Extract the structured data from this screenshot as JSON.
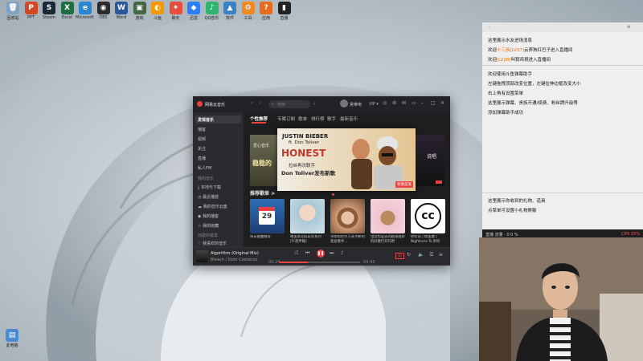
{
  "desktop_icons": [
    {
      "label": "回收站",
      "color": "#7fa3c4",
      "glyph": "🗑"
    },
    {
      "label": "PPT",
      "color": "#d24726",
      "glyph": "P"
    },
    {
      "label": "Steam",
      "color": "#1b2838",
      "glyph": "S"
    },
    {
      "label": "Excel",
      "color": "#1d6f42",
      "glyph": "X"
    },
    {
      "label": "Microsoft Edge",
      "color": "#2a86d1",
      "glyph": "e"
    },
    {
      "label": "OBS",
      "color": "#2b2b2b",
      "glyph": "◉"
    },
    {
      "label": "Word",
      "color": "#2b579a",
      "glyph": "W"
    },
    {
      "label": "游戏",
      "color": "#446644",
      "glyph": "▣"
    },
    {
      "label": "斗鱼",
      "color": "#f39800",
      "glyph": "◐"
    },
    {
      "label": "聊天",
      "color": "#e84d3d",
      "glyph": "✦"
    },
    {
      "label": "迅雷",
      "color": "#2d7ff9",
      "glyph": "◆"
    },
    {
      "label": "QQ音乐",
      "color": "#2fb56f",
      "glyph": "♪"
    },
    {
      "label": "软件",
      "color": "#3b82c4",
      "glyph": "▲"
    },
    {
      "label": "工具",
      "color": "#f08a24",
      "glyph": "⚙"
    },
    {
      "label": "应用",
      "color": "#e86a1a",
      "glyph": "?"
    },
    {
      "label": "直播",
      "color": "#222222",
      "glyph": "▮"
    }
  ],
  "bottom_icon": {
    "label": "此电脑"
  },
  "music": {
    "app_title": "网易云音乐",
    "side_heading": "发现音乐",
    "side_items": [
      "播客",
      "视频",
      "关注",
      "直播",
      "私人FM"
    ],
    "my_music_heading": "我的音乐",
    "my_items": [
      "本地与下载",
      "最近播放",
      "我的音乐云盘",
      "我的播客",
      "我的收藏"
    ],
    "created_heading": "创建的歌单",
    "playlist_item": "我喜欢的音乐",
    "tabs": [
      "个性推荐",
      "专属订制",
      "歌单",
      "排行榜",
      "歌手",
      "最新音乐"
    ],
    "banner_title": "JUSTIN BIEBER",
    "banner_sub": "ft. Don Toliver",
    "banner_song": "HONEST",
    "banner_cn1": "拉丝再次联手",
    "banner_cn2": "Don Toliver发布新歌",
    "banner_left": "稳稳的",
    "banner_left_small": "爱心音乐",
    "banner_right": "说唱",
    "banner_badge": "新歌首发",
    "rec_heading": "推荐歌单 >",
    "cards": [
      {
        "caption": "每日歌曲推荐",
        "date": "29"
      },
      {
        "caption": "唯美系完成日常系列 [午夜伴睡]",
        "date": ""
      },
      {
        "caption": "带你的听众入耳不断的现女歌手...",
        "date": ""
      },
      {
        "caption": "电音控是去的越来越好的好歌打开吗吧",
        "date": ""
      },
      {
        "caption": "聆听日 | 欧美圈 | Nightcore To 聆听",
        "date": ""
      }
    ],
    "song_title": "Algorithm (Original Mix)",
    "song_artist": "Bleach / Dom Costanzo",
    "time_current": "00:24",
    "time_total": "04:43",
    "lyric_badge": "词",
    "progress": 0.35,
    "user": "吴带电",
    "search_placeholder": "搜索"
  },
  "chat": {
    "top_left": "⋯",
    "lines": [
      {
        "text": "这里展示水友进场消息",
        "accent": ""
      },
      {
        "pre": "欢迎",
        "tag": "十三族[LV37]",
        "rest": "云养狗红巴子进入直播间"
      },
      {
        "pre": "欢迎",
        "tag": "[LV28]",
        "rest": "叫我鸡哥进入直播间"
      },
      {
        "text": "欢迎使用斗鱼弹幕助手",
        "accent": ""
      },
      {
        "text": "左键拖拽顶部改变位置，左键拉伸边框改变大小",
        "accent": ""
      },
      {
        "text": "右上角有设置菜单",
        "accent": ""
      },
      {
        "text": "这里展示弹幕、贵族开通/续费、粉丝牌升级等",
        "accent": ""
      },
      {
        "text": "添加弹幕助手成功",
        "accent": ""
      },
      {
        "text": "这里展示你收到的礼物、道具",
        "accent": ""
      },
      {
        "text": "点菜单可设置小礼物屏蔽",
        "accent": ""
      }
    ],
    "status_left": "直播 流量 · 0.0 %",
    "status_right": "CPU 15%"
  },
  "colors": {
    "accent": "#ec4141",
    "chat_tag": "#ff6a00"
  }
}
